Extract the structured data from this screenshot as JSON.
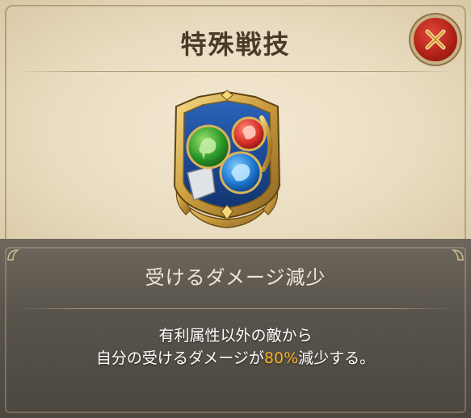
{
  "dialog": {
    "title": "特殊戦技",
    "close_label": "close"
  },
  "skill": {
    "name": "受けるダメージ減少",
    "description_line1": "有利属性以外の敵から",
    "description_line2_before": "自分の受けるダメージが",
    "description_value": "80%",
    "description_line2_after": "減少する。"
  },
  "icons": {
    "badge": "elemental-shield-badge-icon",
    "close": "close-x-icon"
  },
  "colors": {
    "highlight": "#f7b52c",
    "close_button": "#b22218",
    "parchment": "#ecdfc4",
    "dark_panel": "#5a554c"
  }
}
